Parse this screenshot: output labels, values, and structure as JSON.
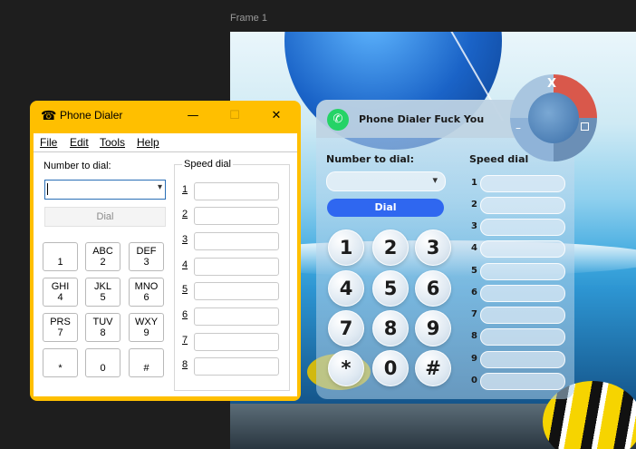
{
  "canvas": {
    "frame_label": "Frame 1"
  },
  "classic_window": {
    "title": "Phone Dialer",
    "controls": {
      "minimize": "—",
      "maximize": "☐",
      "close": "✕"
    },
    "menus": [
      {
        "label": "File"
      },
      {
        "label": "Edit"
      },
      {
        "label": "Tools"
      },
      {
        "label": "Help"
      }
    ],
    "number_label": "Number to dial:",
    "number_value": "",
    "dial_label": "Dial",
    "keys": [
      {
        "main": "",
        "sub": "1"
      },
      {
        "main": "ABC",
        "sub": "2"
      },
      {
        "main": "DEF",
        "sub": "3"
      },
      {
        "main": "GHI",
        "sub": "4"
      },
      {
        "main": "JKL",
        "sub": "5"
      },
      {
        "main": "MNO",
        "sub": "6"
      },
      {
        "main": "PRS",
        "sub": "7"
      },
      {
        "main": "TUV",
        "sub": "8"
      },
      {
        "main": "WXY",
        "sub": "9"
      },
      {
        "main": "",
        "sub": "*"
      },
      {
        "main": "",
        "sub": "0"
      },
      {
        "main": "",
        "sub": "#"
      }
    ],
    "speed_dial_label": "Speed dial",
    "speed_dial_numbers": [
      "1",
      "2",
      "3",
      "4",
      "5",
      "6",
      "7",
      "8"
    ]
  },
  "glass_window": {
    "title": "Phone Dialer Fuck You",
    "app_icon": "whatsapp-icon",
    "number_label": "Number to dial:",
    "dial_label": "Dial",
    "keys": [
      "1",
      "2",
      "3",
      "4",
      "5",
      "6",
      "7",
      "8",
      "9",
      "*",
      "0",
      "#"
    ],
    "speed_dial_label": "Speed dial",
    "speed_dial_numbers": [
      "1",
      "2",
      "3",
      "4",
      "5",
      "6",
      "7",
      "8",
      "9",
      "0"
    ],
    "controls": {
      "close": "X",
      "minimize": "–"
    }
  },
  "colors": {
    "window_border": "#ffbf00",
    "dial_accent": "#2f67f0",
    "whatsapp_green": "#25d366"
  }
}
